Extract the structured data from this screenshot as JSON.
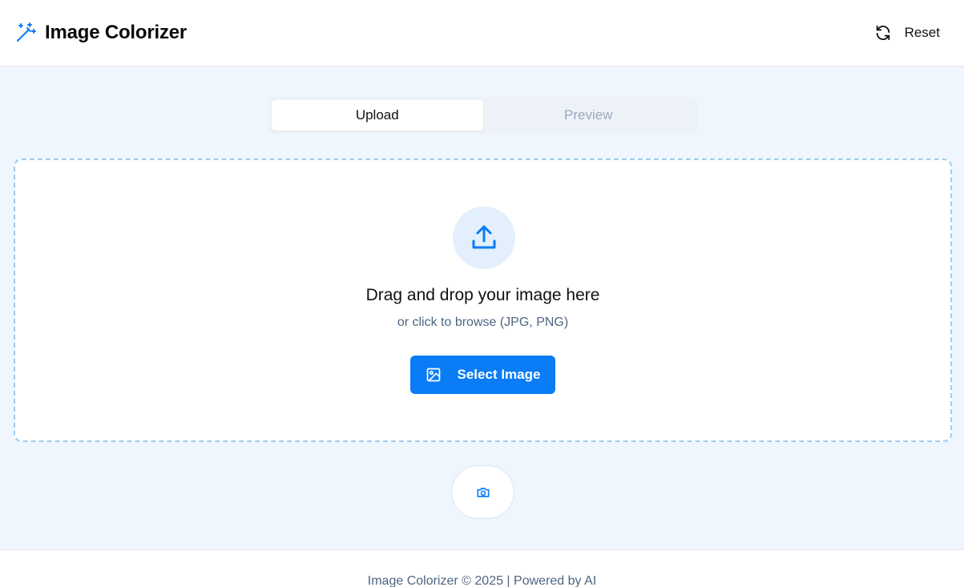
{
  "header": {
    "title": "Image Colorizer",
    "brand_icon": "magic-wand-icon",
    "reset_label": "Reset",
    "reset_icon": "refresh-icon"
  },
  "tabs": [
    {
      "label": "Upload",
      "active": true
    },
    {
      "label": "Preview",
      "active": false
    }
  ],
  "dropzone": {
    "icon": "upload-icon",
    "title": "Drag and drop your image here",
    "subtitle": "or click to browse (JPG, PNG)",
    "button_label": "Select Image",
    "button_icon": "image-icon"
  },
  "camera_button": {
    "icon": "camera-icon"
  },
  "footer": {
    "text": "Image Colorizer © 2025 | Powered by AI"
  },
  "colors": {
    "accent": "#0a7cf5",
    "background": "#eff6fd",
    "dropzone_border": "#9cccf2",
    "muted_text": "#4f6582",
    "inactive_tab": "#9aa9bd"
  }
}
